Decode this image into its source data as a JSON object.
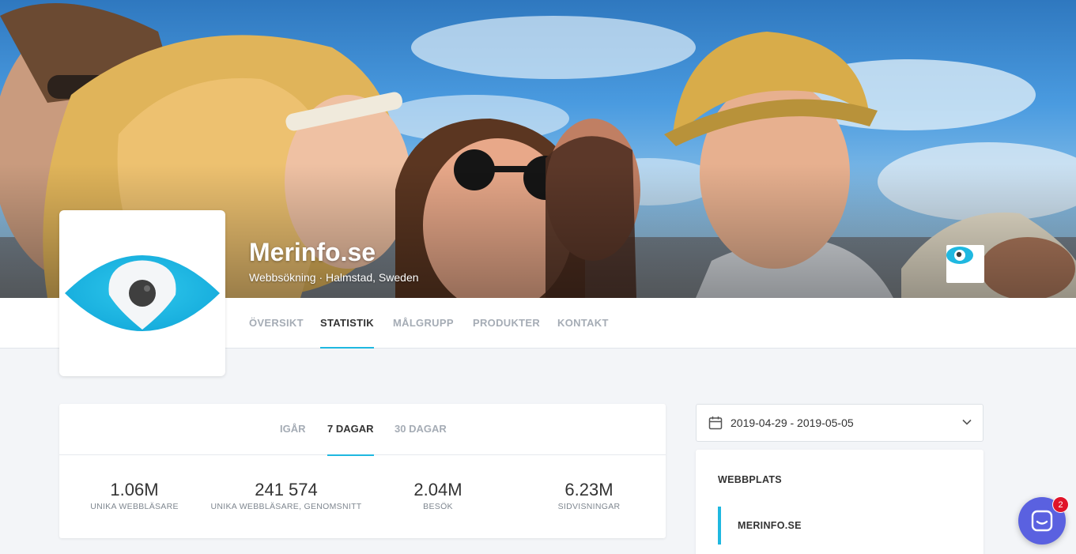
{
  "profile": {
    "title": "Merinfo.se",
    "subtitle": "Webbsökning · Halmstad, Sweden",
    "accent_color": "#1fb8e0",
    "logo_icon": "eye-icon"
  },
  "nav": {
    "tabs": [
      {
        "label": "ÖVERSIKT",
        "active": false
      },
      {
        "label": "STATISTIK",
        "active": true
      },
      {
        "label": "MÅLGRUPP",
        "active": false
      },
      {
        "label": "PRODUKTER",
        "active": false
      },
      {
        "label": "KONTAKT",
        "active": false
      }
    ]
  },
  "stats": {
    "periods": [
      {
        "label": "IGÅR",
        "active": false
      },
      {
        "label": "7 DAGAR",
        "active": true
      },
      {
        "label": "30 DAGAR",
        "active": false
      }
    ],
    "metrics": [
      {
        "value": "1.06M",
        "label": "UNIKA WEBBLÄSARE"
      },
      {
        "value": "241 574",
        "label": "UNIKA WEBBLÄSARE, GENOMSNITT"
      },
      {
        "value": "2.04M",
        "label": "BESÖK"
      },
      {
        "value": "6.23M",
        "label": "SIDVISNINGAR"
      }
    ]
  },
  "date_range": {
    "value": "2019-04-29 - 2019-05-05",
    "icon": "calendar-icon"
  },
  "sites": {
    "heading": "WEBBPLATS",
    "items": [
      {
        "label": "MERINFO.SE",
        "active": true
      }
    ]
  },
  "chat": {
    "icon": "chat-icon",
    "unread_count": "2",
    "color": "#5a61e0"
  }
}
